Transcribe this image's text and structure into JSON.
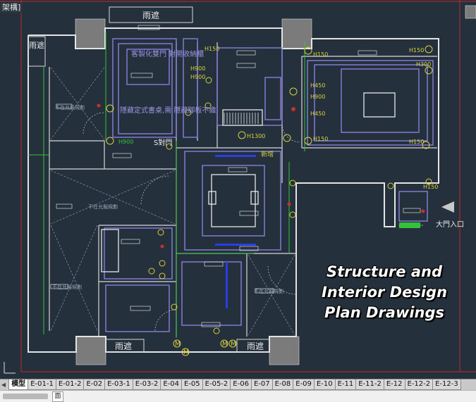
{
  "window": {
    "title_fragment": "架構]"
  },
  "drawing": {
    "labels": {
      "top_canopy": "雨遮",
      "bottom_canopy_left": "雨遮",
      "bottom_canopy_right": "雨遮",
      "left_canopy": "雨遮",
      "ref1": "客製化雙門\n對開收納櫃",
      "ref2": "隱藏定式書桌,需\n隱藏腳板不織",
      "s_label": "S對門",
      "new_label": "新增",
      "entrance": "大門入口",
      "h1": "H900",
      "h2": "H900",
      "h3": "H900",
      "h4": "H900",
      "h5": "H450",
      "h6": "H450",
      "h7": "H150",
      "h8": "H150",
      "h9": "H150",
      "h10": "H1300",
      "h11": "H150",
      "h12": "H150",
      "h13": "H150",
      "h14": "H300",
      "note1": "不在允擬規劃",
      "note2": "不在允擬規劃",
      "note3": "不在允擬規劃",
      "note4": "不在允擬規劃",
      "m1": "M",
      "m2": "M",
      "m3": "M",
      "m4": "M"
    }
  },
  "overlay": {
    "line1": "Structure and",
    "line2": "Interior Design",
    "line3": "Plan Drawings"
  },
  "tabs": {
    "items": [
      "模型",
      "E-01-1",
      "E-01-2",
      "E-02",
      "E-03-1",
      "E-03-2",
      "E-04",
      "E-05",
      "E-05-2",
      "E-06",
      "E-07",
      "E-08",
      "E-09",
      "E-10",
      "E-11",
      "E-11-2",
      "E-12",
      "E-12-2",
      "E-12-3"
    ]
  },
  "status": {
    "field": "面"
  },
  "colors": {
    "bg": "#24303b",
    "wall": "#e8e8e8",
    "furniture": "#8f86e8",
    "green": "#35c23a",
    "yellow": "#d8d040",
    "red": "#d02828",
    "blue": "#2a3be8"
  }
}
